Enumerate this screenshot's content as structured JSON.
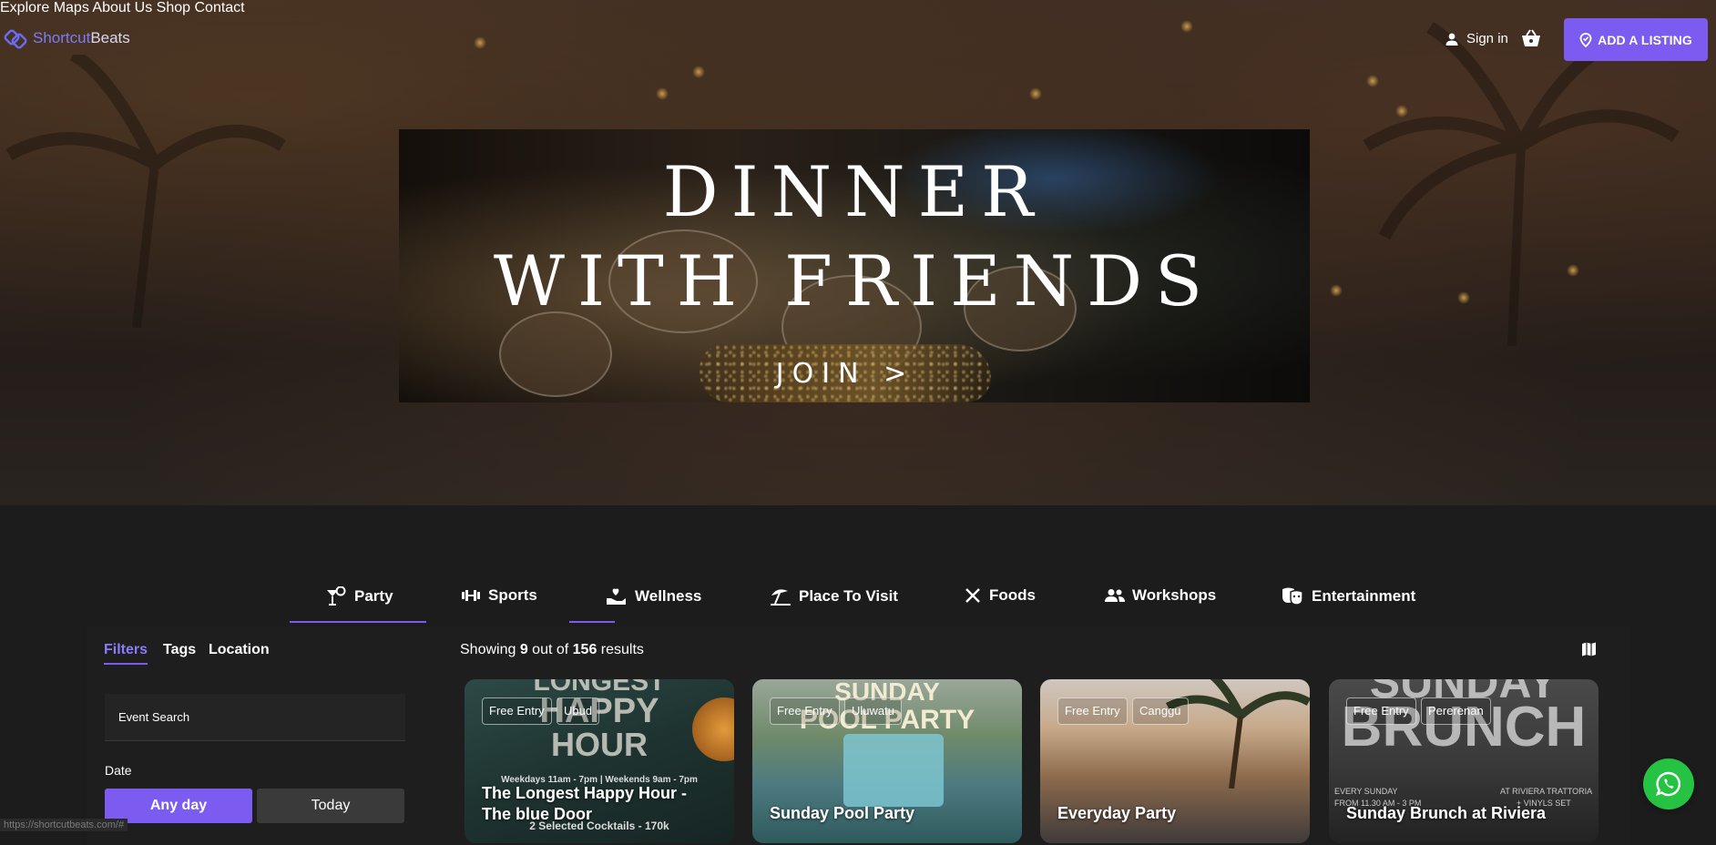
{
  "brand": {
    "logo_part1": "Shortcut",
    "logo_part2": "Beats"
  },
  "nav": {
    "items": [
      "Explore",
      "Maps",
      "About Us",
      "Shop",
      "Contact"
    ],
    "sign_in": "Sign in",
    "add_listing": "ADD A LISTING"
  },
  "banner": {
    "line1": "DINNER",
    "line2": "WITH FRIENDS",
    "cta": "JOIN >"
  },
  "categories": [
    "Party",
    "Sports",
    "Wellness",
    "Place To Visit",
    "Foods",
    "Workshops",
    "Entertainment"
  ],
  "filters": {
    "tabs": [
      "Filters",
      "Tags",
      "Location"
    ],
    "search_placeholder": "Event Search",
    "date_label": "Date",
    "any_day": "Any day",
    "today": "Today"
  },
  "results": {
    "prefix": "Showing ",
    "shown": "9",
    "middle": " out of ",
    "total": "156",
    "suffix": " results"
  },
  "cards": [
    {
      "chip1": "Free Entry",
      "chip2": "Ubud",
      "title": "The Longest Happy Hour - The blue Door",
      "bg_line1": "LONGEST",
      "bg_line2": "HAPPY",
      "bg_line3": "HOUR",
      "bg_small1": "Weekdays 11am - 7pm | Weekends 9am - 7pm",
      "bg_small2": "2 Selected Cocktails - 170k"
    },
    {
      "chip1": "Free Entry",
      "chip2": "Uluwatu",
      "title": "Sunday Pool Party",
      "bg_line1": "SUNDAY",
      "bg_line2": "POOL PARTY"
    },
    {
      "chip1": "Free Entry",
      "chip2": "Canggu",
      "title": "Everyday Party"
    },
    {
      "chip1": "Free Entry",
      "chip2": "Pererenan",
      "title": "Sunday Brunch at Riviera",
      "bg_line1": "SUNDAY",
      "bg_line2": "BRUNCH",
      "bg_small1": "EVERY SUNDAY",
      "bg_small2": "AT RIVIERA TRATTORIA",
      "bg_small3": "FROM 11.30 AM - 3 PM",
      "bg_small4": "+ VINYLS SET"
    }
  ],
  "status_url": "https://shortcutbeats.com/#",
  "colors": {
    "accent": "#7c5cf0",
    "whatsapp": "#25c244",
    "background": "#1c1c1c"
  }
}
